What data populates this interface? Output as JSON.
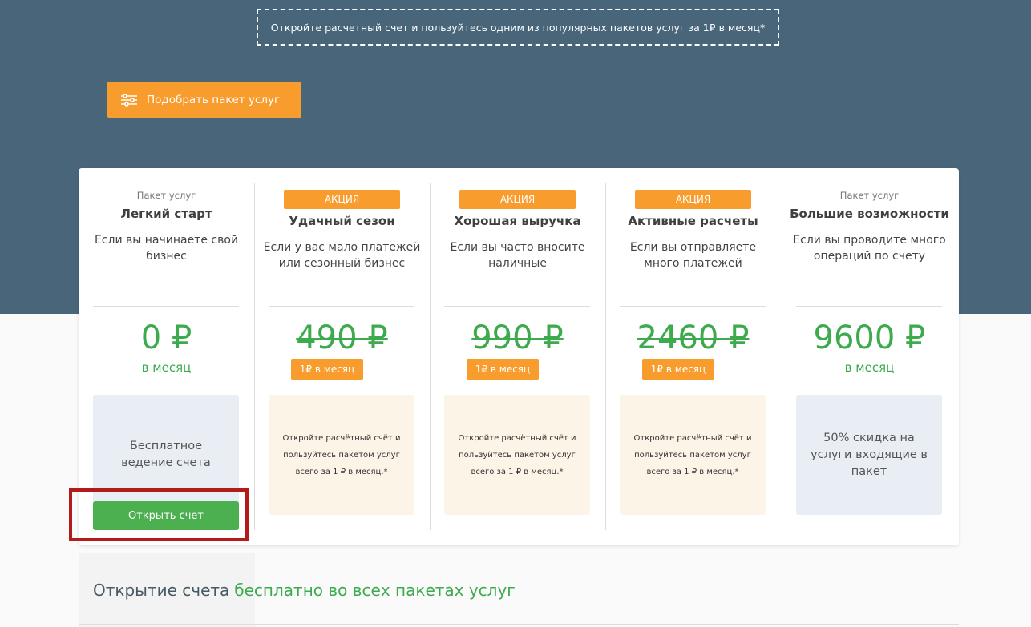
{
  "header": {
    "promo_text": "Откройте расчетный счет и пользуйтесь одним из популярных пакетов услуг за 1₽ в месяц*",
    "pick_button_label": "Подобрать пакет услуг",
    "pick_button_icon": "sliders-icon"
  },
  "colors": {
    "hero_bg": "#48657a",
    "accent_orange": "#f89c2e",
    "price_green": "#3daa4e",
    "button_green": "#4caf50",
    "highlight_red": "#b41a1a"
  },
  "plans": [
    {
      "pre": "Пакет услуг",
      "name": "Легкий старт",
      "desc": "Если вы начинаете свой бизнес",
      "price": "0 ₽",
      "per": "в месяц",
      "box": "Бесплатное ведение счета"
    },
    {
      "badge": "АКЦИЯ",
      "name": "Удачный сезон",
      "desc": "Если у вас мало платежей или сезонный бизнес",
      "price": "490 ₽",
      "promo_price": "1₽ в месяц",
      "box": "Откройте расчётный счёт и пользуйтесь пакетом услуг всего за 1 ₽ в месяц.*"
    },
    {
      "badge": "АКЦИЯ",
      "name": "Хорошая выручка",
      "desc": "Если вы часто вносите наличные",
      "price": "990 ₽",
      "promo_price": "1₽ в месяц",
      "box": "Откройте расчётный счёт и пользуйтесь пакетом услуг всего за 1 ₽ в месяц.*"
    },
    {
      "badge": "АКЦИЯ",
      "name": "Активные расчеты",
      "desc": "Если вы отправляете много платежей",
      "price": "2460 ₽",
      "promo_price": "1₽ в месяц",
      "box": "Откройте расчётный счёт и пользуйтесь пакетом услуг всего за 1 ₽ в месяц.*"
    },
    {
      "pre": "Пакет услуг",
      "name": "Большие возможности",
      "desc": "Если вы проводите много операций по счету",
      "price": "9600 ₽",
      "per": "в месяц",
      "box": "50% скидка на услуги входящие в пакет"
    }
  ],
  "open_button_label": "Открыть счет",
  "bottom": {
    "title": "Открытие счета",
    "highlight": "бесплатно во всех пакетах услуг"
  }
}
